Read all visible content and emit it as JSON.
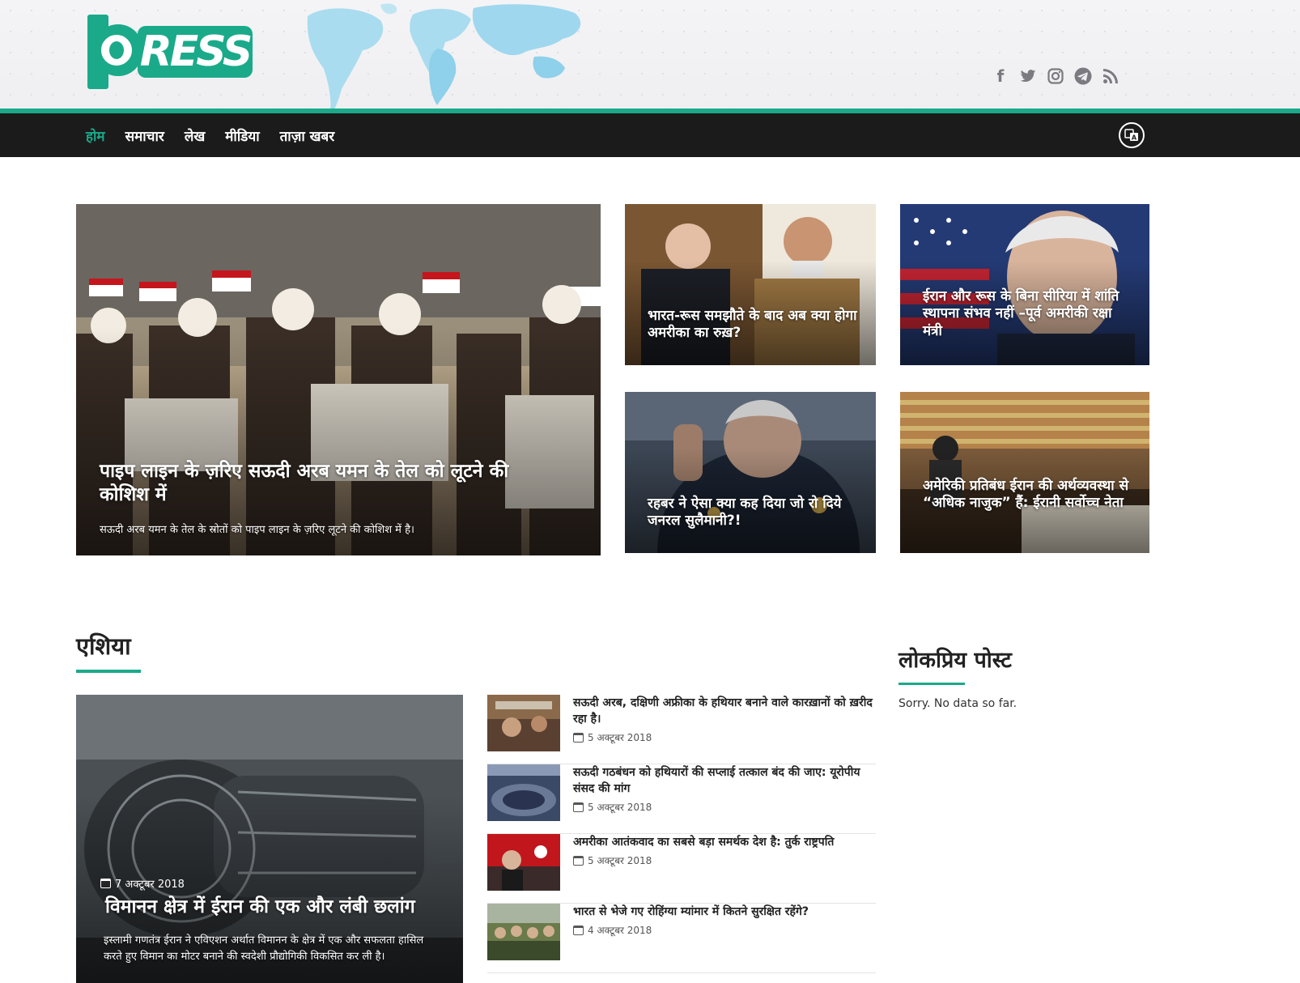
{
  "header": {
    "logo_text": "RESS",
    "social_icons": [
      "facebook-icon",
      "twitter-icon",
      "instagram-icon",
      "telegram-icon",
      "rss-icon"
    ],
    "accent_color": "#1aaa8a"
  },
  "nav": {
    "items": [
      {
        "label": "होम",
        "active": true
      },
      {
        "label": "समाचार",
        "active": false
      },
      {
        "label": "लेख",
        "active": false
      },
      {
        "label": "मीडिया",
        "active": false
      },
      {
        "label": "ताज़ा खबर",
        "active": false
      }
    ],
    "lang_icon": "translate-icon"
  },
  "featured": {
    "main": {
      "title": "पाइप लाइन के ज़रिए सऊदी अरब यमन के तेल को लूटने की कोशिश में",
      "excerpt": "सऊदी अरब यमन के तेल के स्रोतों को पाइप लाइन के ज़रिए लूटने की कोशिश में है।"
    },
    "side": [
      {
        "title": "भारत-रूस समझौते के बाद अब क्या होगा अमरीका का रुख़?"
      },
      {
        "title": "ईरान और रूस के बिना सीरिया में शांति स्थापना संभव नहीं –पूर्व अमरीकी रक्षा मंत्री"
      },
      {
        "title": "रहबर ने ऐसा क्या कह दिया जो रो दिये जनरल सुलैमानी?!"
      },
      {
        "title": "अमेरिकी प्रतिबंध ईरान की अर्थव्यवस्था से “अधिक नाजुक” हैं: ईरानी सर्वोच्च नेता"
      }
    ]
  },
  "asia": {
    "heading": "एशिया",
    "lead": {
      "date": "7 अक्टूबर 2018",
      "title": "विमानन क्षेत्र में ईरान की एक और लंबी छलांग",
      "excerpt": "इस्लामी गणतंत्र ईरान ने एविएशन अर्थात विमानन के क्षेत्र में एक और सफलता हासिल करते हुए विमान का मोटर बनाने की स्वदेशी प्रौद्योगिकी विकसित कर ली है।"
    },
    "list": [
      {
        "title": "सऊदी अरब, दक्षिणी अफ्रीका के हथियार बनाने वाले कारख़ानों को ख़रीद रहा है।",
        "date": "5 अक्टूबर 2018"
      },
      {
        "title": "सऊदी गठबंधन को हथियारों की सप्लाई तत्काल बंद की जाए: यूरोपीय संसद की मांग",
        "date": "5 अक्टूबर 2018"
      },
      {
        "title": "अमरीका आतंकवाद का सबसे बड़ा समर्थक देश है: तुर्क राष्ट्रपति",
        "date": "5 अक्टूबर 2018"
      },
      {
        "title": "भारत से भेजे गए रोहिंग्या म्यांमार में कितने सुरक्षित रहेंगे?",
        "date": "4 अक्टूबर 2018"
      }
    ]
  },
  "sidebar": {
    "heading": "लोकप्रिय पोस्ट",
    "empty_text": "Sorry. No data so far."
  }
}
